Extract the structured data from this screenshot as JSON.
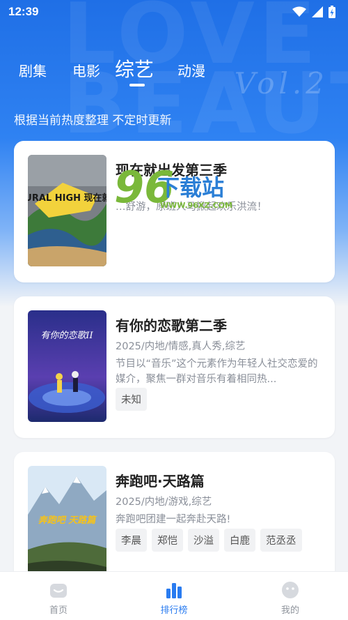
{
  "status_bar": {
    "time": "12:39"
  },
  "hero": {
    "deco_text": "LOVE BEAUTY",
    "deco_vol": "Vol.2"
  },
  "tabs": [
    {
      "label": "剧集",
      "active": false
    },
    {
      "label": "电影",
      "active": false
    },
    {
      "label": "综艺",
      "active": true
    },
    {
      "label": "动漫",
      "active": false
    }
  ],
  "subtitle": "根据当前热度整理 不定时更新",
  "cards": [
    {
      "title": "现在就出发第三季",
      "meta": "",
      "description": "…舒游，原班人马掀起欢乐洪流！",
      "tags": []
    },
    {
      "title": "有你的恋歌第二季",
      "meta": "2025/内地/情感,真人秀,综艺",
      "description": "节目以“音乐”这个元素作为年轻人社交恋爱的媒介，聚焦一群对音乐有着相同热...",
      "tags": [
        "未知"
      ]
    },
    {
      "title": "奔跑吧·天路篇",
      "meta": "2025/内地/游戏,综艺",
      "description": "奔跑吧团建一起奔赴天路!",
      "tags": [
        "李晨",
        "郑恺",
        "沙溢",
        "白鹿",
        "范丞丞"
      ]
    }
  ],
  "posters": [
    {
      "caption": "NATURAL HIGH 现在就出发"
    },
    {
      "caption": "有你的恋歌II"
    },
    {
      "caption": "奔跑吧 天路篇"
    }
  ],
  "watermark": {
    "num": "96",
    "text": "下载站",
    "url": "WWW.96XZ.COM"
  },
  "bottom_nav": [
    {
      "label": "首页",
      "icon": "home-icon",
      "active": false
    },
    {
      "label": "排行榜",
      "icon": "chart-icon",
      "active": true
    },
    {
      "label": "我的",
      "icon": "profile-icon",
      "active": false
    }
  ],
  "colors": {
    "hero_blue": "#1f6fe6",
    "accent": "#2a7cf0",
    "title": "#222222",
    "meta": "#8a8f99"
  }
}
